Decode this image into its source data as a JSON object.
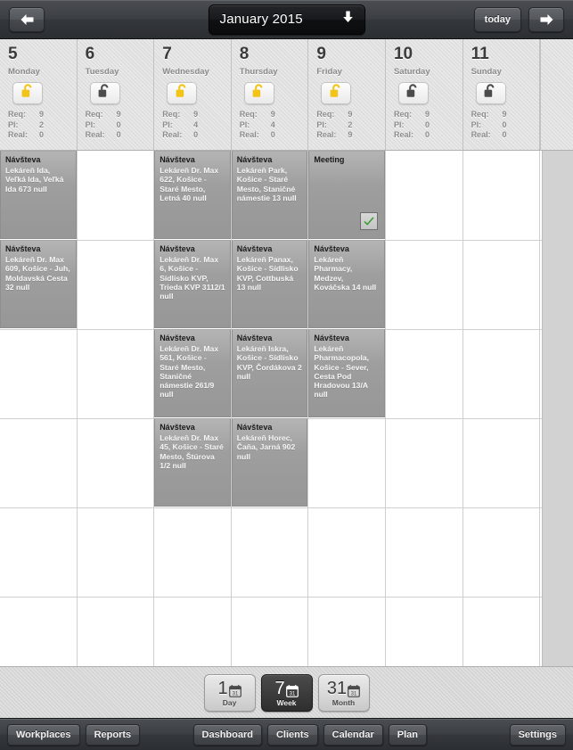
{
  "topbar": {
    "prev_label": "prev-arrow",
    "title": "January 2015",
    "today_label": "today",
    "next_label": "next-arrow"
  },
  "days": [
    {
      "num": "5",
      "dow": "Monday",
      "locked": false,
      "lock_color": "#f2c417",
      "req_key": "Req:",
      "req_val": "9",
      "pl_key": "Pl:",
      "pl_val": "2",
      "real_key": "Real:",
      "real_val": "0"
    },
    {
      "num": "6",
      "dow": "Tuesday",
      "locked": false,
      "lock_color": "#4c4c4c",
      "req_key": "Req:",
      "req_val": "9",
      "pl_key": "Pl:",
      "pl_val": "0",
      "real_key": "Real:",
      "real_val": "0"
    },
    {
      "num": "7",
      "dow": "Wednesday",
      "locked": false,
      "lock_color": "#f2c417",
      "req_key": "Req:",
      "req_val": "9",
      "pl_key": "Pl:",
      "pl_val": "4",
      "real_key": "Real:",
      "real_val": "0"
    },
    {
      "num": "8",
      "dow": "Thursday",
      "locked": false,
      "lock_color": "#f2c417",
      "req_key": "Req:",
      "req_val": "9",
      "pl_key": "Pl:",
      "pl_val": "4",
      "real_key": "Real:",
      "real_val": "0"
    },
    {
      "num": "9",
      "dow": "Friday",
      "locked": false,
      "lock_color": "#f2c417",
      "req_key": "Req:",
      "req_val": "9",
      "pl_key": "Pl:",
      "pl_val": "2",
      "real_key": "Real:",
      "real_val": "9"
    },
    {
      "num": "10",
      "dow": "Saturday",
      "locked": false,
      "lock_color": "#4c4c4c",
      "req_key": "Req:",
      "req_val": "9",
      "pl_key": "Pl:",
      "pl_val": "0",
      "real_key": "Real:",
      "real_val": "0"
    },
    {
      "num": "11",
      "dow": "Sunday",
      "locked": false,
      "lock_color": "#4c4c4c",
      "req_key": "Req:",
      "req_val": "9",
      "pl_key": "Pl:",
      "pl_val": "0",
      "real_key": "Real:",
      "real_val": "0"
    }
  ],
  "events": [
    {
      "col": 0,
      "row": 0,
      "title": "Návšteva",
      "body": "Lekáreň Ida, Veľká Ida, Veľká Ida 673 null",
      "checkbox": false
    },
    {
      "col": 2,
      "row": 0,
      "title": "Návšteva",
      "body": "Lekáreň Dr. Max 622, Košice - Staré Mesto, Letná 40 null",
      "checkbox": false
    },
    {
      "col": 3,
      "row": 0,
      "title": "Návšteva",
      "body": "Lekáreň Park, Košice - Staré Mesto, Staničné námestie 13 null",
      "checkbox": false
    },
    {
      "col": 4,
      "row": 0,
      "title": "Meeting",
      "body": "",
      "checkbox": true
    },
    {
      "col": 0,
      "row": 1,
      "title": "Návšteva",
      "body": "Lekáreň Dr. Max 609, Košice - Juh, Moldavská Cesta 32 null",
      "checkbox": false
    },
    {
      "col": 2,
      "row": 1,
      "title": "Návšteva",
      "body": "Lekáreň Dr. Max 6, Košice - Sídlisko KVP, Trieda KVP 3112/1 null",
      "checkbox": false
    },
    {
      "col": 3,
      "row": 1,
      "title": "Návšteva",
      "body": "Lekáreň Panax, Košice - Sídlisko KVP, Cottbuská 13 null",
      "checkbox": false
    },
    {
      "col": 4,
      "row": 1,
      "title": "Návšteva",
      "body": "Lekáreň Pharmacy, Medzev, Kováčska 14 null",
      "checkbox": false
    },
    {
      "col": 2,
      "row": 2,
      "title": "Návšteva",
      "body": "Lekáreň Dr. Max 561, Košice - Staré Mesto, Staničné námestie 261/9 null",
      "checkbox": false
    },
    {
      "col": 3,
      "row": 2,
      "title": "Návšteva",
      "body": "Lekáreň Iskra, Košice - Sídlisko KVP, Čordákova 2 null",
      "checkbox": false
    },
    {
      "col": 4,
      "row": 2,
      "title": "Návšteva",
      "body": "Lekáreň Pharmacopola, Košice - Sever, Cesta Pod Hradovou 13/A null",
      "checkbox": false
    },
    {
      "col": 2,
      "row": 3,
      "title": "Návšteva",
      "body": "Lekáreň Dr. Max 45, Košice - Staré Mesto, Štúrova 1/2 null",
      "checkbox": false
    },
    {
      "col": 3,
      "row": 3,
      "title": "Návšteva",
      "body": "Lekáreň Horec, Čaňa, Jarná 902 null",
      "checkbox": false
    }
  ],
  "view_segments": [
    {
      "num": "1",
      "label": "Day",
      "icon_day": "31",
      "active": false
    },
    {
      "num": "7",
      "label": "Week",
      "icon_day": "31",
      "active": true
    },
    {
      "num": "31",
      "label": "Month",
      "icon_day": "31",
      "active": false
    }
  ],
  "toolbar": {
    "left": [
      "Workplaces",
      "Reports"
    ],
    "center": [
      "Dashboard",
      "Clients",
      "Calendar",
      "Plan"
    ],
    "right": [
      "Settings"
    ]
  },
  "colors": {
    "accent_yellow": "#f2c417",
    "check_green": "#3f9c35",
    "event_gray": "#9e9e9e",
    "chrome_dark": "#3c3f44"
  }
}
